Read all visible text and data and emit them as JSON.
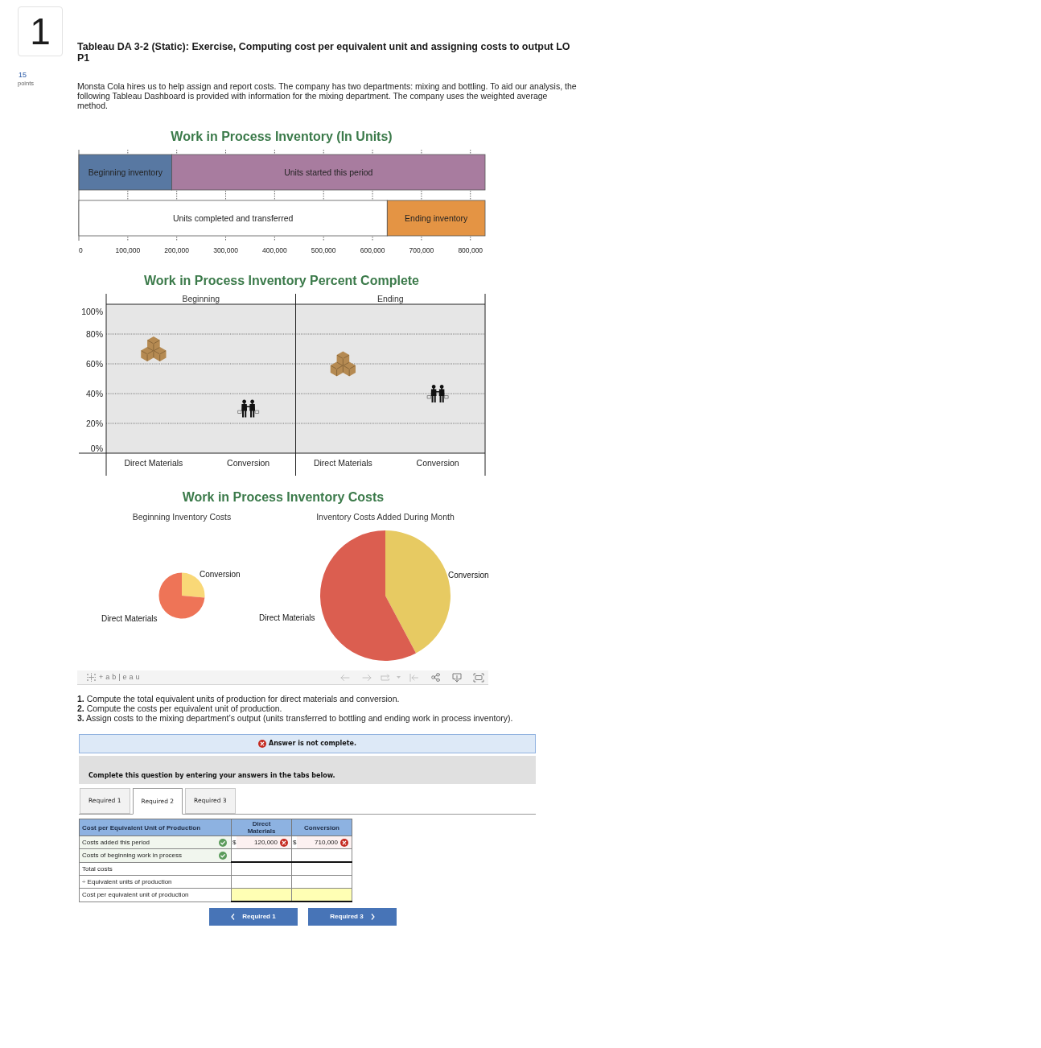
{
  "question": {
    "number": "1",
    "points": "15",
    "points_label": "points"
  },
  "title": "Tableau DA 3-2 (Static): Exercise, Computing cost per equivalent unit and assigning costs to output LO P1",
  "intro": "Monsta Cola hires us to help assign and report costs. The company has two departments: mixing and bottling. To aid our analysis, the following Tableau Dashboard is provided with information for the mixing department. The company uses the weighted average method.",
  "units_chart": {
    "chart_data": {
      "type": "bar",
      "title": "Work in Process Inventory (In Units)",
      "orientation": "horizontal",
      "stacked": true,
      "grid": true,
      "series": [
        {
          "name": "Beginning inventory",
          "color": "#5878a2",
          "values": [
            190000,
            null
          ]
        },
        {
          "name": "Units started this period",
          "color": "#a87c9f",
          "values": [
            640000,
            null
          ]
        },
        {
          "name": "Units completed and transferred",
          "color": "#ffffff",
          "values": [
            null,
            630000
          ]
        },
        {
          "name": "Ending inventory",
          "color": "#e49444",
          "values": [
            null,
            200000
          ]
        }
      ],
      "xlim": [
        0,
        830000
      ],
      "xticks": [
        {
          "value": 0,
          "label": "0"
        },
        {
          "value": 100000,
          "label": "100,000"
        },
        {
          "value": 200000,
          "label": "200,000"
        },
        {
          "value": 300000,
          "label": "300,000"
        },
        {
          "value": 400000,
          "label": "400,000"
        },
        {
          "value": 500000,
          "label": "500,000"
        },
        {
          "value": 600000,
          "label": "600,000"
        },
        {
          "value": 700000,
          "label": "700,000"
        },
        {
          "value": 800000,
          "label": "800,000"
        }
      ]
    }
  },
  "percent_chart": {
    "panels": [
      {
        "label": "Beginning"
      },
      {
        "label": "Ending"
      }
    ],
    "chart_data": {
      "type": "scatter",
      "title": "Work in Process Inventory Percent Complete",
      "categories": [
        "Direct Materials",
        "Conversion",
        "Direct Materials",
        "Conversion"
      ],
      "series": [
        {
          "color": "#b58a52",
          "values": [
            70,
            null,
            60,
            null
          ]
        },
        {
          "color": "#111111",
          "values": [
            null,
            30,
            null,
            40
          ]
        }
      ],
      "ylim": [
        0,
        100
      ],
      "grid": true,
      "yticks": [
        {
          "value": 100,
          "label": "100%"
        },
        {
          "value": 80,
          "label": "80%"
        },
        {
          "value": 60,
          "label": "60%"
        },
        {
          "value": 40,
          "label": "40%"
        },
        {
          "value": 20,
          "label": "20%"
        },
        {
          "value": 0,
          "label": "0%"
        }
      ]
    }
  },
  "costs_chart": {
    "title": "Work in Process Inventory Costs",
    "pies": [
      {
        "title": "Beginning Inventory Costs",
        "slices": [
          {
            "label": "Conversion",
            "color": "#f9d877"
          },
          {
            "label": "Direct Materials",
            "color": "#ee7457"
          }
        ]
      },
      {
        "title": "Inventory Costs Added During Month",
        "slices": [
          {
            "label": "Conversion",
            "color": "#e7ca62"
          },
          {
            "label": "Direct Materials",
            "color": "#db5e50"
          }
        ]
      }
    ]
  },
  "toolbar": {
    "logo": "+ab|eau",
    "buttons": [
      {
        "kind": "undo",
        "disabled": true
      },
      {
        "kind": "redo",
        "disabled": true
      },
      {
        "kind": "revert",
        "disabled": true
      },
      {
        "kind": "reset",
        "disabled": true
      },
      {
        "kind": "share",
        "disabled": false
      },
      {
        "kind": "download",
        "disabled": false
      },
      {
        "kind": "fullscreen",
        "disabled": false
      }
    ]
  },
  "instructions": [
    {
      "number": "1.",
      "text": "Compute the total equivalent units of production for direct materials and conversion."
    },
    {
      "number": "2.",
      "text": "Compute the costs per equivalent unit of production."
    },
    {
      "number": "3.",
      "text": "Assign costs to the mixing department’s output (units transferred to bottling and ending work in process inventory)."
    }
  ],
  "banner": {
    "complete": false,
    "text": "Answer is not complete."
  },
  "prompt": "Complete this question by entering your answers in the tabs below.",
  "tabs": [
    {
      "label": "Required 1",
      "selected": false
    },
    {
      "label": "Required 2",
      "selected": true
    },
    {
      "label": "Required 3",
      "selected": false
    }
  ],
  "table": {
    "columns": [
      "Cost per Equivalent Unit of Production",
      "Direct Materials",
      "Conversion"
    ],
    "rows": [
      {
        "kind": "input",
        "label": "Costs added this period",
        "label_correct": true,
        "cells": [
          {
            "prefix": "$",
            "value": "120,000",
            "correct": false
          },
          {
            "prefix": "$",
            "value": "710,000",
            "correct": false
          }
        ]
      },
      {
        "kind": "input",
        "label": "Costs of beginning work in process",
        "label_correct": true
      },
      {
        "kind": "total",
        "label": "Total costs"
      },
      {
        "kind": "input",
        "label": "÷ Equivalent units of production"
      },
      {
        "kind": "result",
        "label": "Cost per equivalent unit of production"
      }
    ]
  },
  "nav_buttons": [
    {
      "label": "Required 1",
      "kind": "prev"
    },
    {
      "label": "Required 3",
      "kind": "next"
    }
  ]
}
